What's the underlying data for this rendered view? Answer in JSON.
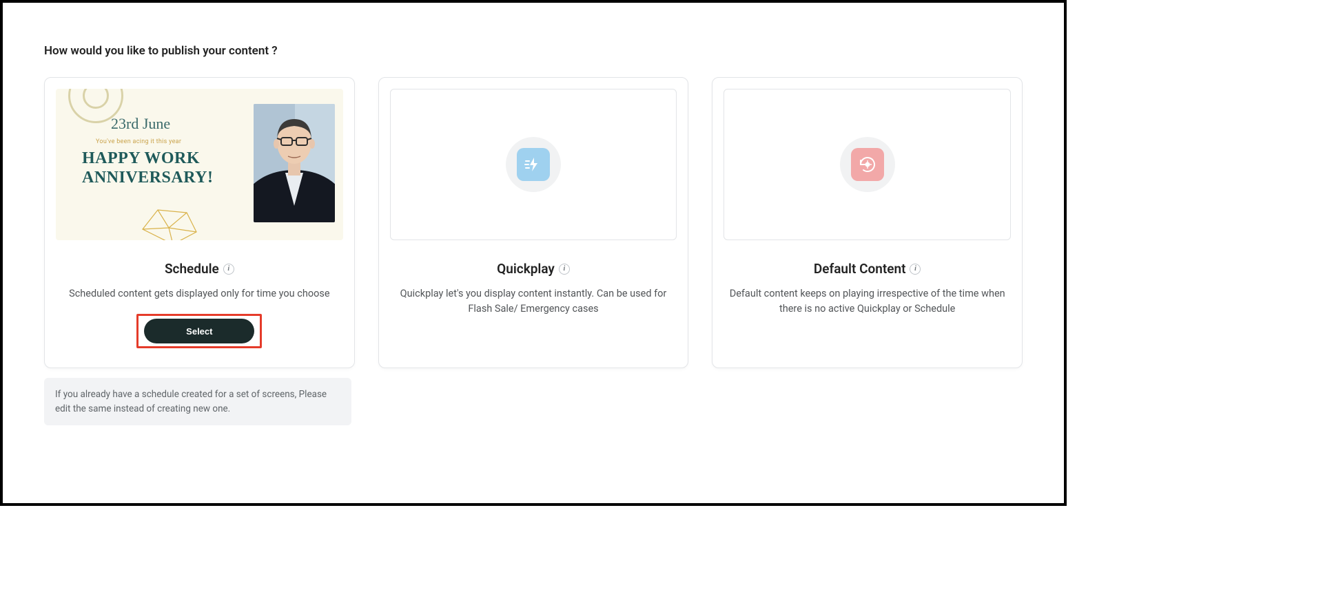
{
  "heading": "How would you like to publish your content ?",
  "schedule": {
    "title": "Schedule",
    "desc": "Scheduled content gets displayed only for time you choose",
    "select_label": "Select",
    "art": {
      "date": "23rd June",
      "sub": "You've been acing it this year",
      "line1": "HAPPY WORK",
      "line2": "ANNIVERSARY!"
    }
  },
  "quickplay": {
    "title": "Quickplay",
    "desc": "Quickplay let's you display content instantly. Can be used for Flash Sale/ Emergency cases"
  },
  "default": {
    "title": "Default Content",
    "desc": "Default content keeps on playing irrespective of the time when there is no active Quickplay or Schedule"
  },
  "note": "If you already have a schedule created for a set of screens, Please edit the same instead of creating new one.",
  "info_glyph": "i"
}
